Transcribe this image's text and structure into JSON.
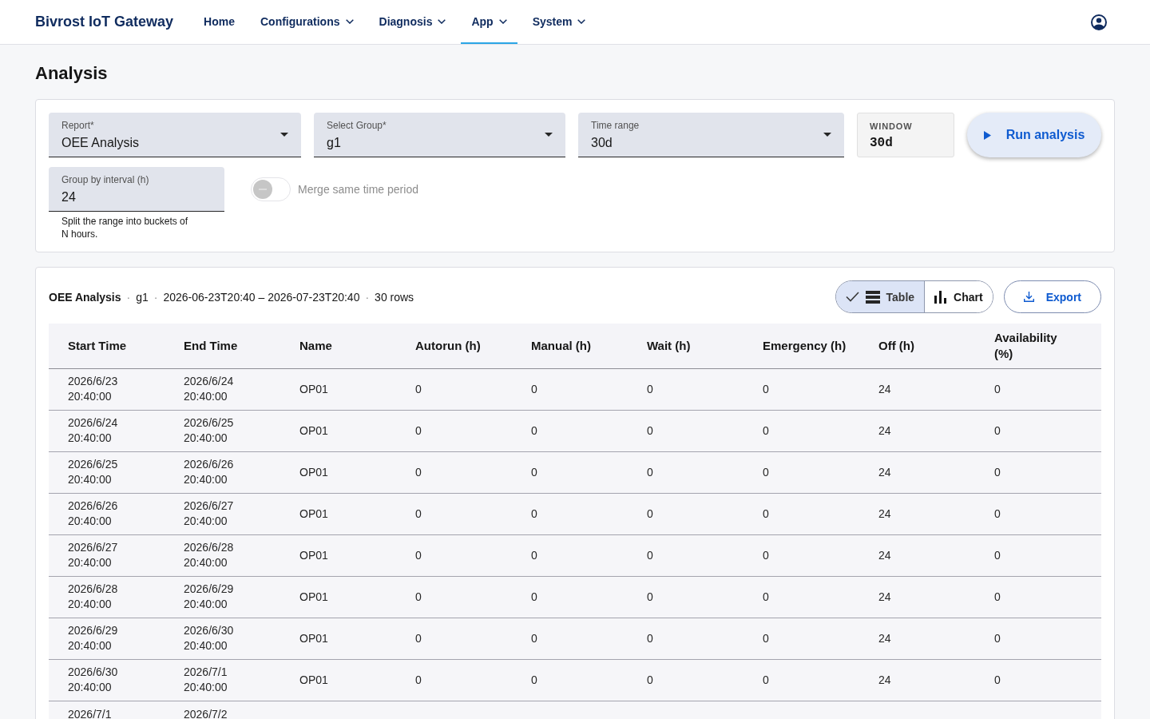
{
  "app_bar": {
    "brand": "Bivrost IoT Gateway",
    "nav": [
      {
        "label": "Home",
        "kind": "link",
        "selected": false
      },
      {
        "label": "Configurations",
        "kind": "menu",
        "selected": false
      },
      {
        "label": "Diagnosis",
        "kind": "menu",
        "selected": false
      },
      {
        "label": "App",
        "kind": "menu",
        "selected": true
      },
      {
        "label": "System",
        "kind": "menu",
        "selected": false
      }
    ]
  },
  "page": {
    "title": "Analysis"
  },
  "form": {
    "fields": [
      {
        "kind": "select",
        "label": "Report*",
        "value": "OEE Analysis"
      },
      {
        "kind": "select",
        "label": "Select Group*",
        "value": "g1"
      },
      {
        "kind": "select",
        "label": "Time range",
        "value": "30d"
      },
      {
        "kind": "readout",
        "label": "WINDOW",
        "value": "30d"
      }
    ],
    "run_button": {
      "label": "Run analysis"
    },
    "interval": {
      "label": "Group by interval (h)",
      "value": "24",
      "helper": "Split the range into buckets of N hours."
    },
    "merge": {
      "label": "Merge same time period",
      "on": false,
      "disabled": true
    }
  },
  "results": {
    "summary": [
      {
        "kind": "title",
        "text": "OEE Analysis"
      },
      {
        "kind": "separator",
        "text": "·"
      },
      {
        "kind": "text",
        "text": "g1"
      },
      {
        "kind": "separator",
        "text": "·"
      },
      {
        "kind": "text",
        "text": "2026-06-23T20:40 – 2026-07-23T20:40"
      },
      {
        "kind": "separator",
        "text": "·"
      },
      {
        "kind": "text",
        "text": "30 rows"
      }
    ],
    "view_options": [
      {
        "kind": "table",
        "label": "Table",
        "selected": true
      },
      {
        "kind": "chart",
        "label": "Chart",
        "selected": false
      }
    ],
    "export_button": {
      "label": "Export"
    },
    "table": {
      "columns": [
        {
          "label": "Start Time",
          "kind": "datetime"
        },
        {
          "label": "End Time",
          "kind": "datetime"
        },
        {
          "label": "Name",
          "kind": "text"
        },
        {
          "label": "Autorun (h)",
          "kind": "number"
        },
        {
          "label": "Manual (h)",
          "kind": "number"
        },
        {
          "label": "Wait (h)",
          "kind": "number"
        },
        {
          "label": "Emergency (h)",
          "kind": "number"
        },
        {
          "label": "Off (h)",
          "kind": "number"
        },
        {
          "label": "Availability (%)",
          "kind": "number"
        }
      ],
      "rows": [
        [
          "2026/6/23 20:40:00",
          "2026/6/24 20:40:00",
          "OP01",
          "0",
          "0",
          "0",
          "0",
          "24",
          "0"
        ],
        [
          "2026/6/24 20:40:00",
          "2026/6/25 20:40:00",
          "OP01",
          "0",
          "0",
          "0",
          "0",
          "24",
          "0"
        ],
        [
          "2026/6/25 20:40:00",
          "2026/6/26 20:40:00",
          "OP01",
          "0",
          "0",
          "0",
          "0",
          "24",
          "0"
        ],
        [
          "2026/6/26 20:40:00",
          "2026/6/27 20:40:00",
          "OP01",
          "0",
          "0",
          "0",
          "0",
          "24",
          "0"
        ],
        [
          "2026/6/27 20:40:00",
          "2026/6/28 20:40:00",
          "OP01",
          "0",
          "0",
          "0",
          "0",
          "24",
          "0"
        ],
        [
          "2026/6/28 20:40:00",
          "2026/6/29 20:40:00",
          "OP01",
          "0",
          "0",
          "0",
          "0",
          "24",
          "0"
        ],
        [
          "2026/6/29 20:40:00",
          "2026/6/30 20:40:00",
          "OP01",
          "0",
          "0",
          "0",
          "0",
          "24",
          "0"
        ],
        [
          "2026/6/30 20:40:00",
          "2026/7/1 20:40:00",
          "OP01",
          "0",
          "0",
          "0",
          "0",
          "24",
          "0"
        ],
        [
          "2026/7/1",
          "2026/7/2"
        ]
      ]
    }
  }
}
